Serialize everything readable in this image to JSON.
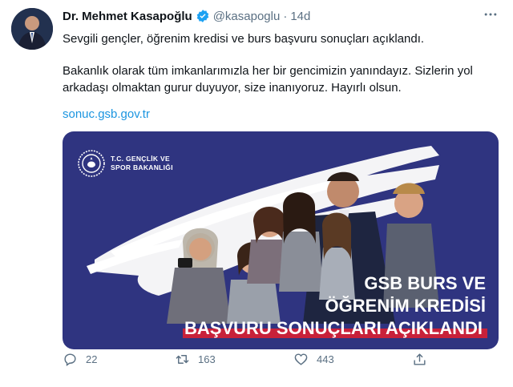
{
  "tweet": {
    "author_name": "Dr. Mehmet Kasapoğlu",
    "handle": "@kasapoglu",
    "separator": "·",
    "time": "14d",
    "more_icon": "more-horizontal-icon",
    "paragraph1": "Sevgili gençler, öğrenim kredisi ve burs başvuru sonuçları açıklandı.",
    "paragraph2": "Bakanlık olarak tüm imkanlarımızla her bir gencimizin yanındayız. Sizlerin yol arkadaşı olmaktan gurur duyuyor, size inanıyoruz. Hayırlı olsun.",
    "link": "sonuc.gsb.gov.tr"
  },
  "media": {
    "ministry_line1": "T.C. GENÇLİK VE",
    "ministry_line2": "SPOR BAKANLIĞI",
    "headline_line1": "GSB BURS VE",
    "headline_line2": "ÖĞRENİM KREDİSİ",
    "headline_line3": "BAŞVURU SONUÇLARI AÇIKLANDI",
    "background_color": "#2f3480",
    "accent_color": "#c8213a"
  },
  "actions": {
    "reply_count": "22",
    "retweet_count": "163",
    "like_count": "443"
  },
  "colors": {
    "verified": "#1da1f2",
    "link": "#1b95e0",
    "muted": "#5b7083"
  }
}
